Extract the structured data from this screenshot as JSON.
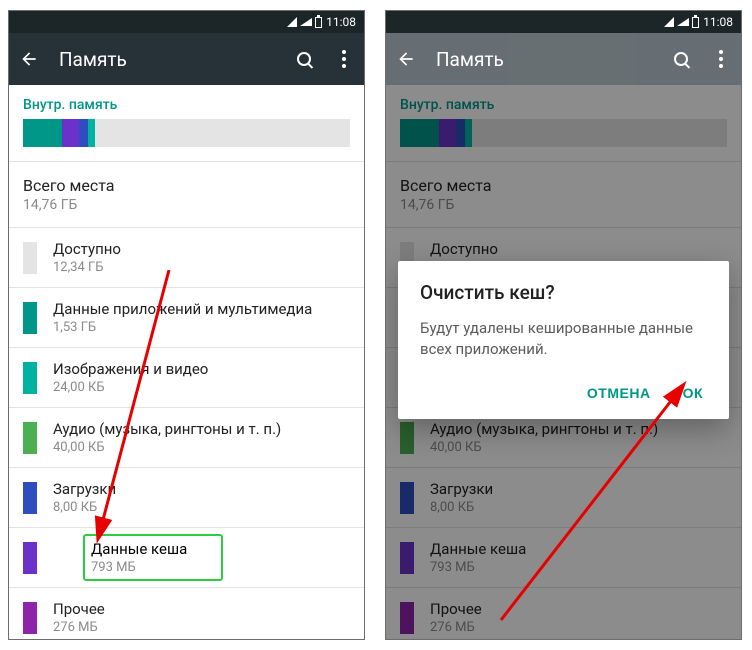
{
  "statusbar": {
    "time": "11:08"
  },
  "appbar": {
    "title": "Память"
  },
  "section_label": "Внутр. память",
  "total": {
    "label": "Всего места",
    "value": "14,76 ГБ"
  },
  "rows": [
    {
      "label": "Доступно",
      "value": "12,34 ГБ",
      "color": "#e4e4e4"
    },
    {
      "label": "Данные приложений и мультимедиа",
      "value": "1,53 ГБ",
      "color": "#009688"
    },
    {
      "label": "Изображения и видео",
      "value": "24,00 КБ",
      "color": "#00b3a0"
    },
    {
      "label": "Аудио (музыка, рингтоны и т. п.)",
      "value": "40,00 КБ",
      "color": "#4caf50"
    },
    {
      "label": "Загрузки",
      "value": "8,00 КБ",
      "color": "#2e4ec0"
    },
    {
      "label": "Данные кеша",
      "value": "793 МБ",
      "color": "#6a32c9"
    },
    {
      "label": "Прочее",
      "value": "276 МБ",
      "color": "#8e24aa"
    }
  ],
  "bar_segments": [
    {
      "color": "#009688",
      "width": 12
    },
    {
      "color": "#6a32c9",
      "width": 5
    },
    {
      "color": "#2e4ec0",
      "width": 3
    },
    {
      "color": "#00b3a0",
      "width": 2
    }
  ],
  "dialog": {
    "title": "Очистить кеш?",
    "body": "Будут удалены кешированные данные всех приложений.",
    "cancel": "ОТМЕНА",
    "ok": "ОК"
  }
}
